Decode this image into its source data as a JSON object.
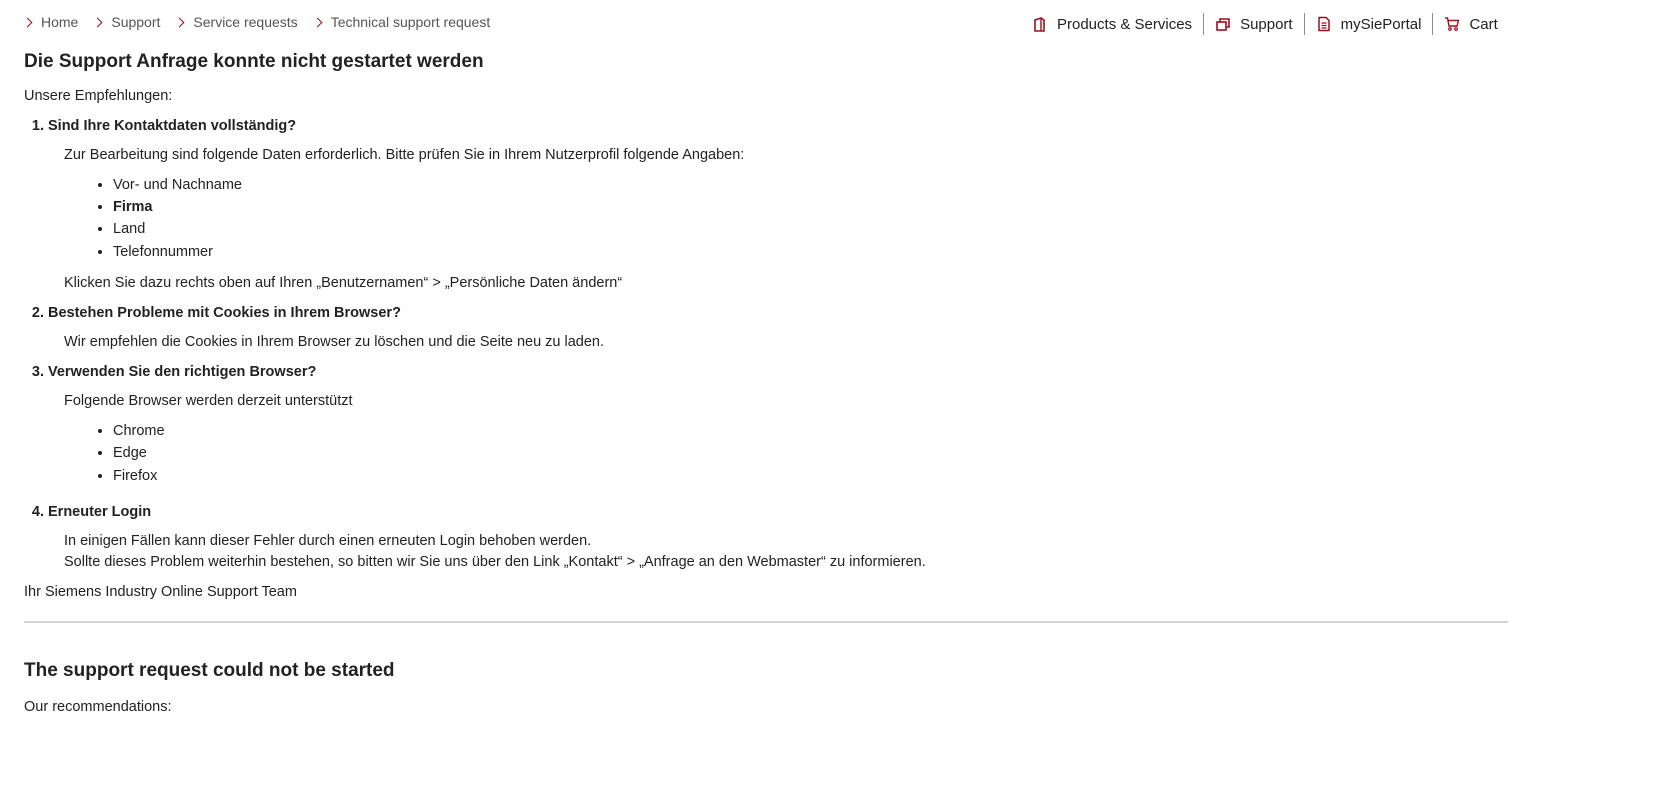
{
  "breadcrumb": [
    "Home",
    "Support",
    "Service requests",
    "Technical support request"
  ],
  "topnav": {
    "items": [
      {
        "label": "Products & Services",
        "icon": "products-icon"
      },
      {
        "label": "Support",
        "icon": "support-icon"
      },
      {
        "label": "mySiePortal",
        "icon": "document-icon"
      },
      {
        "label": "Cart",
        "icon": "cart-icon"
      }
    ],
    "accent": "#9a0e1e"
  },
  "de": {
    "title": "Die Support Anfrage konnte nicht gestartet werden",
    "intro": "Unsere Empfehlungen:",
    "recs": [
      {
        "heading": "Sind Ihre Kontaktdaten vollständig?",
        "text": "Zur Bearbeitung sind folgende Daten erforderlich. Bitte prüfen Sie in Ihrem Nutzerprofil folgende Angaben:",
        "bullets": [
          "Vor- und Nachname",
          "Firma",
          "Land",
          "Telefonnummer"
        ],
        "after": "Klicken Sie dazu rechts oben auf Ihren „Benutzernamen“ > „Persönliche Daten ändern“"
      },
      {
        "heading": "Bestehen Probleme mit Cookies in Ihrem Browser?",
        "text": "Wir empfehlen die Cookies in Ihrem Browser zu löschen und die Seite neu zu laden."
      },
      {
        "heading": "Verwenden Sie den richtigen Browser?",
        "text": "Folgende Browser werden derzeit unterstützt",
        "bullets": [
          "Chrome",
          "Edge",
          "Firefox"
        ]
      },
      {
        "heading": "Erneuter Login",
        "text": "In einigen Fällen kann dieser Fehler durch einen erneuten Login behoben werden.",
        "text2": "Sollte dieses Problem weiterhin bestehen, so bitten wir Sie uns über den Link „Kontakt“ > „Anfrage an den Webmaster“ zu informieren."
      }
    ],
    "sign": "Ihr Siemens Industry Online Support Team"
  },
  "en": {
    "title": "The support request could not be started",
    "intro": "Our recommendations:"
  }
}
